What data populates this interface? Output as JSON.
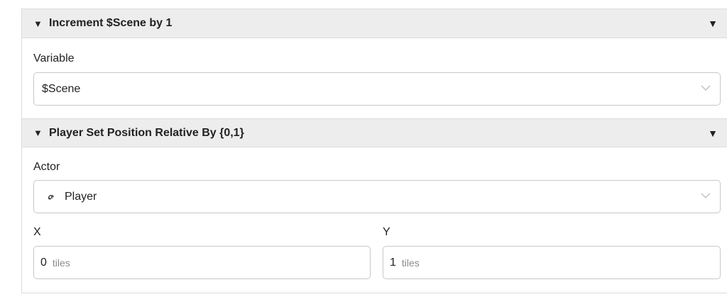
{
  "events": {
    "increment": {
      "title": "Increment $Scene by 1",
      "variable_label": "Variable",
      "variable_value": "$Scene"
    },
    "set_position": {
      "title": "Player Set Position Relative By {0,1}",
      "actor_label": "Actor",
      "actor_value": "Player",
      "x_label": "X",
      "x_value": "0",
      "x_unit": "tiles",
      "y_label": "Y",
      "y_value": "1",
      "y_unit": "tiles"
    }
  },
  "icons": {
    "collapse": "caret-down-icon",
    "menu": "caret-down-icon",
    "select": "chevron-down-icon",
    "actor": "actor-sprite-icon"
  },
  "colors": {
    "header_bg": "#ededed",
    "border": "#c8c8c8",
    "unit_text": "#8a8a8a"
  }
}
